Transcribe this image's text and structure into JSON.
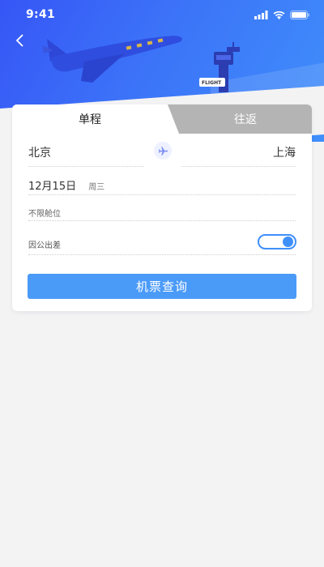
{
  "status_bar": {
    "time": "9:41",
    "icons": [
      "signal-icon",
      "wifi-icon",
      "battery-icon"
    ]
  },
  "header": {
    "back_icon": "chevron-left-icon",
    "illustration_sign": "FLIGHT"
  },
  "tabs": [
    {
      "label": "单程",
      "active": true
    },
    {
      "label": "往返",
      "active": false
    }
  ],
  "route": {
    "from_city": "北京",
    "to_city": "上海",
    "swap_icon": "plane-icon"
  },
  "date": {
    "value": "12月15日",
    "weekday": "周三"
  },
  "cabin": {
    "value": "不限舱位"
  },
  "business_trip": {
    "label": "因公出差",
    "enabled": true
  },
  "search_button": {
    "label": "机票查询"
  },
  "colors": {
    "hero_start": "#3656f6",
    "hero_end": "#3f8ffb",
    "accent": "#4a9af8",
    "tab_inactive_bg": "#b4b4b4",
    "page_bg": "#f3f3f4"
  }
}
